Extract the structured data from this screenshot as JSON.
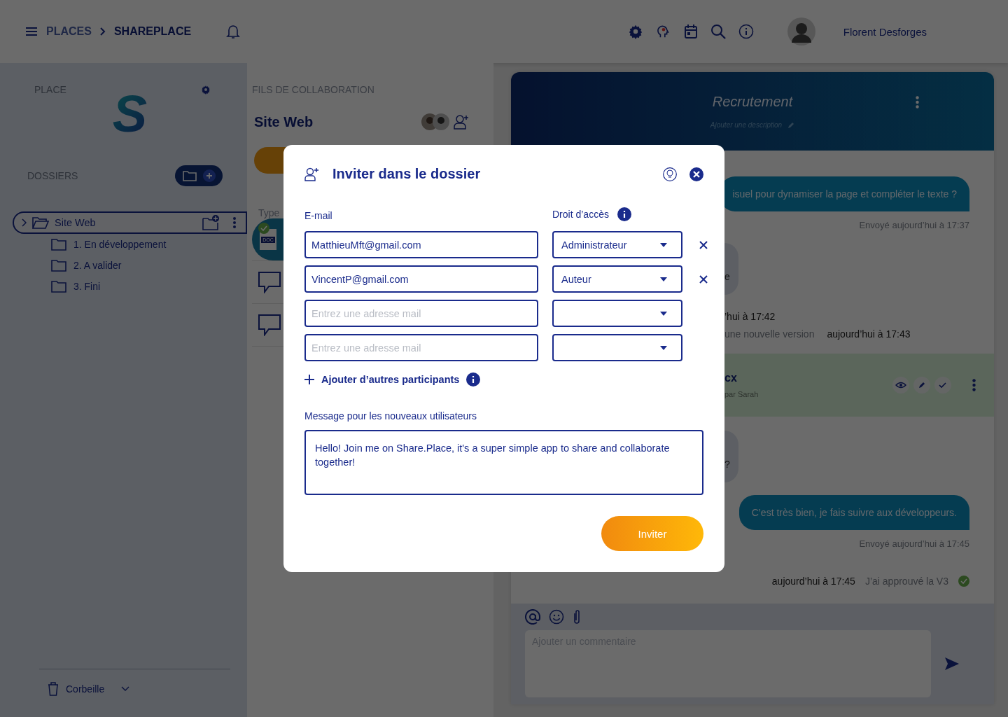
{
  "header": {
    "breadcrumb": [
      "PLACES",
      "SHAREPLACE"
    ],
    "user_name": "Florent Desforges"
  },
  "sidebar": {
    "place_label": "PLACE",
    "logo": "S",
    "folders_label": "DOSSIERS",
    "tree": [
      {
        "label": "Site Web",
        "selected": true,
        "children": [
          {
            "label": "1. En développement",
            "selected": false
          },
          {
            "label": "2. A valider",
            "selected": false
          },
          {
            "label": "3. Fini",
            "selected": false
          }
        ]
      }
    ],
    "trash": "Corbeille"
  },
  "threads": {
    "section_label": "FILS DE COLLABORATION",
    "title": "Site Web",
    "column_label": "Type",
    "items": [
      {
        "kind": "document",
        "badge": "DOC"
      },
      {
        "kind": "comment"
      },
      {
        "kind": "comment"
      }
    ]
  },
  "chat": {
    "title": "Recrutement",
    "description_placeholder": "Ajouter une description",
    "messages": [
      {
        "kind": "outgoing",
        "text": "isuel pour dynamiser la page et compléter le texte ?",
        "meta": "Envoyé aujourd’hui à 17:37"
      },
      {
        "kind": "incoming",
        "text": "e"
      },
      {
        "kind": "event",
        "parts": [
          "’hui à 17:42"
        ]
      },
      {
        "kind": "event",
        "parts": [
          "une nouvelle version",
          "aujourd’hui à 17:43"
        ]
      },
      {
        "kind": "file",
        "name": "cx",
        "info": "par Sarah"
      },
      {
        "kind": "incoming",
        "text": "?"
      },
      {
        "kind": "outgoing",
        "text": "C’est très bien, je fais suivre aux développeurs.",
        "meta": "Envoyé aujourd’hui à 17:45"
      },
      {
        "kind": "approval",
        "parts": [
          "aujourd’hui à 17:45",
          "J’ai approuvé la V3"
        ]
      }
    ],
    "comment_placeholder": "Ajouter un commentaire"
  },
  "modal": {
    "title": "Inviter dans le dossier",
    "email_label": "E-mail",
    "access_label": "Droit d’accès",
    "rows": [
      {
        "email": "MatthieuMft@gmail.com",
        "role": "Administrateur",
        "removable": true
      },
      {
        "email": "VincentP@gmail.com",
        "role": "Auteur",
        "removable": true
      },
      {
        "placeholder": "Entrez une adresse mail",
        "removable": false
      },
      {
        "placeholder": "Entrez une adresse mail",
        "removable": false
      }
    ],
    "add_link": "Ajouter d’autres participants",
    "message_label": "Message pour les nouveaux utilisateurs",
    "message": "Hello! Join me on Share.Place, it's a super simple app to share and collaborate together!",
    "submit": "Inviter"
  }
}
